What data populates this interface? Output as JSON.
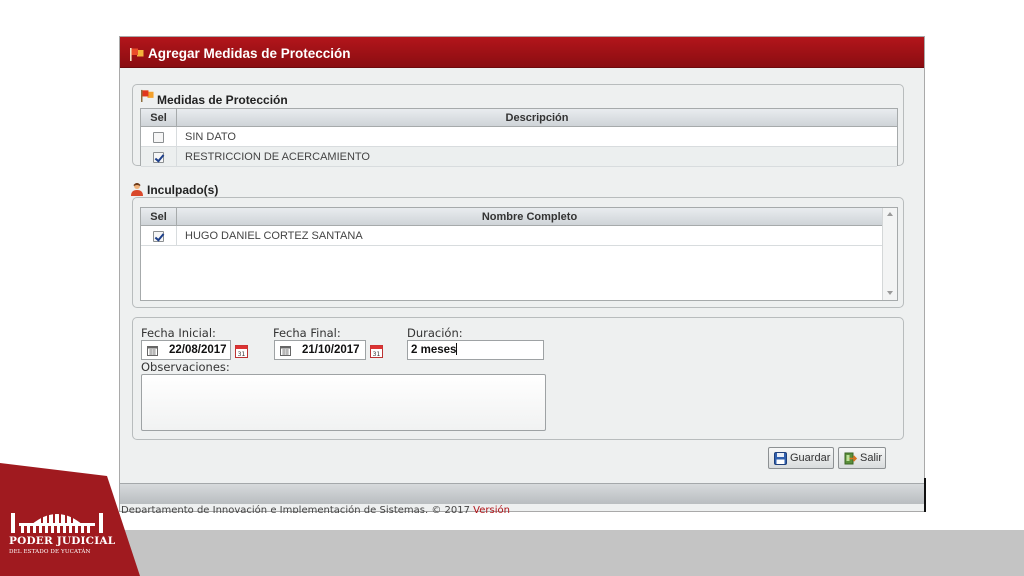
{
  "window": {
    "title": "Agregar Medidas de Protección",
    "title_icon": "flag-icon"
  },
  "medidas": {
    "legend": "Medidas de Protección",
    "legend_icon": "flag-icon",
    "columns": [
      "Sel",
      "Descripción"
    ],
    "rows": [
      {
        "checked": false,
        "descripcion": "SIN DATO"
      },
      {
        "checked": true,
        "descripcion": "RESTRICCION DE ACERCAMIENTO"
      }
    ]
  },
  "inculpados": {
    "legend": "Inculpado(s)",
    "legend_icon": "person-icon",
    "columns": [
      "Sel",
      "Nombre Completo"
    ],
    "rows": [
      {
        "checked": true,
        "nombre": "HUGO DANIEL CORTEZ SANTANA"
      }
    ]
  },
  "form": {
    "fecha_inicial_label": "Fecha Inicial:",
    "fecha_inicial_value": "22/08/2017",
    "fecha_final_label": "Fecha Final:",
    "fecha_final_value": "21/10/2017",
    "duracion_label": "Duración:",
    "duracion_value": "2 meses",
    "observaciones_label": "Observaciones:",
    "observaciones_value": ""
  },
  "buttons": {
    "guardar": "Guardar",
    "guardar_icon": "floppy-disk-icon",
    "salir": "Salir",
    "salir_icon": "exit-icon"
  },
  "footer": {
    "text": "Departamento de Innovación e Implementación de Sistemas. © 2017",
    "link": "Versión"
  },
  "branding": {
    "line1": "PODER JUDICIAL",
    "line2": "DEL ESTADO DE YUCATÁN",
    "accent_color": "#a01a1f"
  }
}
